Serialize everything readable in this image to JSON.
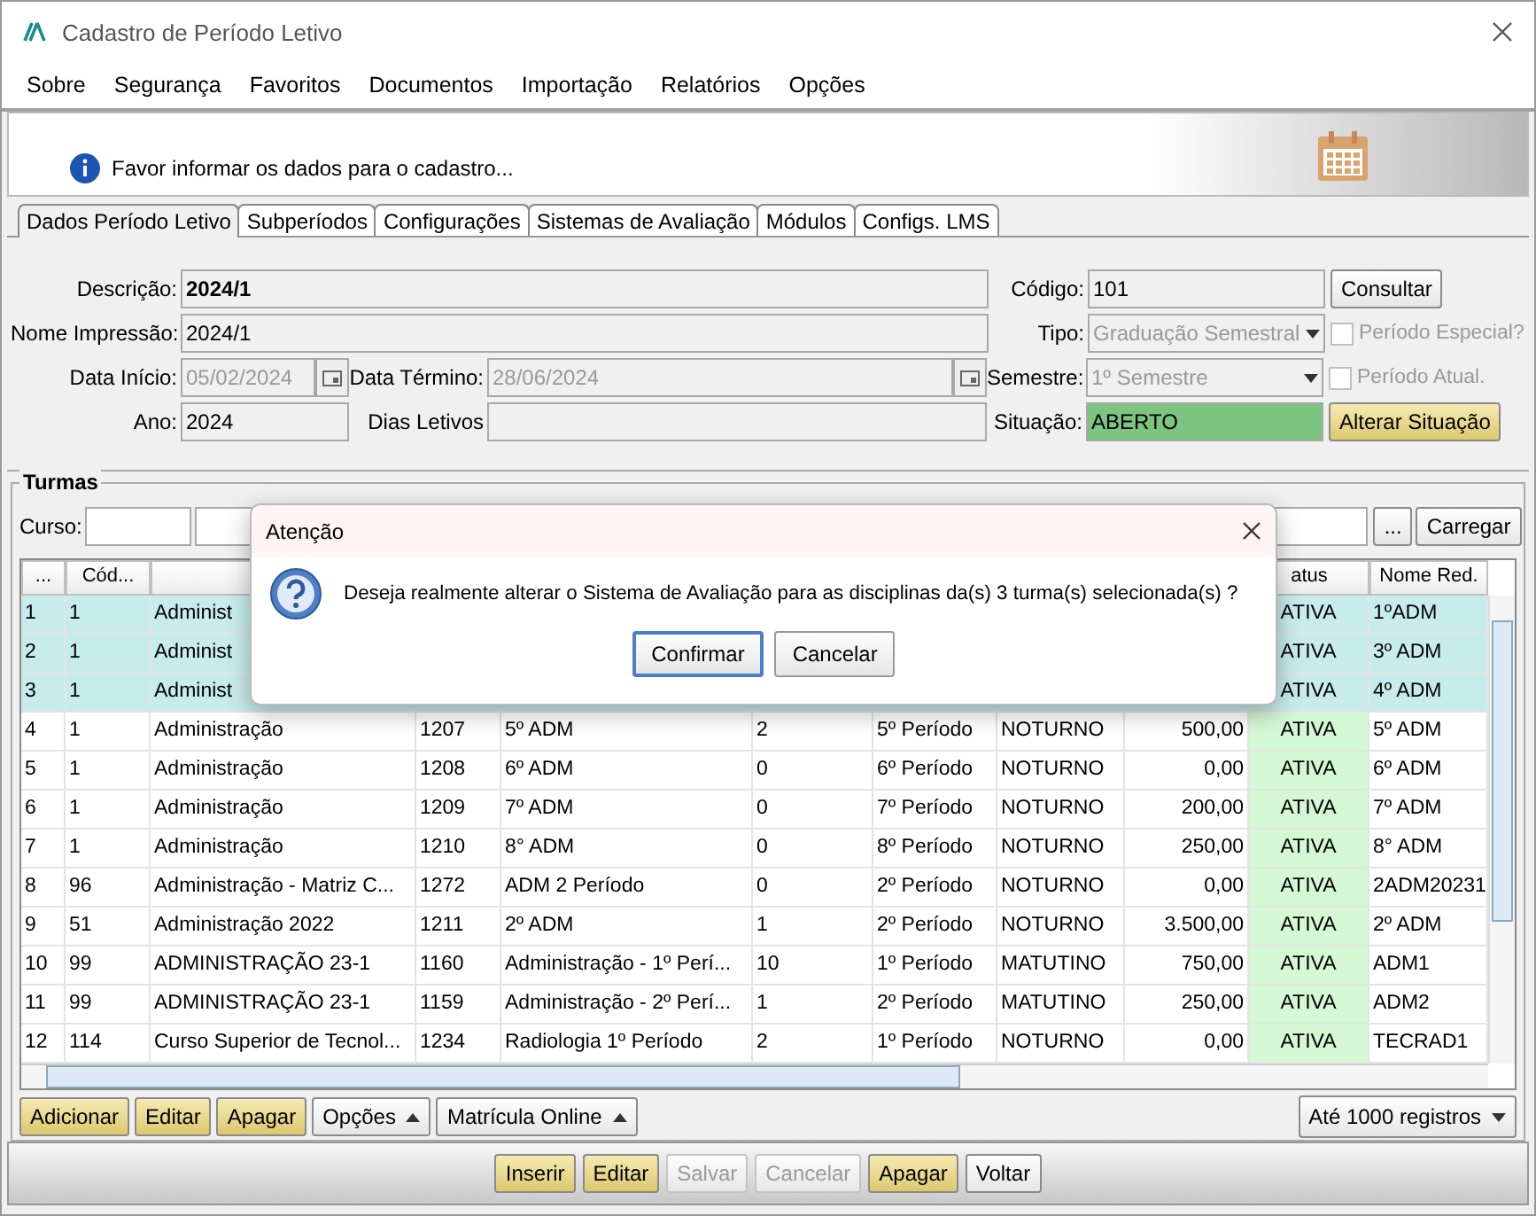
{
  "window": {
    "title": "Cadastro de Período Letivo"
  },
  "menu": [
    "Sobre",
    "Segurança",
    "Favoritos",
    "Documentos",
    "Importação",
    "Relatórios",
    "Opções"
  ],
  "banner": {
    "message": "Favor informar os dados para o cadastro..."
  },
  "tabs": [
    {
      "label": "Dados Período Letivo",
      "selected": true
    },
    {
      "label": "Subperíodos",
      "selected": false
    },
    {
      "label": "Configurações",
      "selected": false
    },
    {
      "label": "Sistemas de Avaliação",
      "selected": false
    },
    {
      "label": "Módulos",
      "selected": false
    },
    {
      "label": "Configs. LMS",
      "selected": false
    }
  ],
  "form": {
    "descricao": {
      "label": "Descrição:",
      "value": "2024/1"
    },
    "nome_impressao": {
      "label": "Nome Impressão:",
      "value": "2024/1"
    },
    "data_inicio": {
      "label": "Data Início:",
      "value": "05/02/2024",
      "disabled": true
    },
    "data_termino": {
      "label": "Data Término:",
      "value": "28/06/2024",
      "disabled": true
    },
    "ano": {
      "label": "Ano:",
      "value": "2024"
    },
    "dias_letivos": {
      "label": "Dias Letivos"
    },
    "codigo": {
      "label": "Código:",
      "value": "101"
    },
    "consultar": {
      "label": "Consultar",
      "kind": "plain"
    },
    "tipo": {
      "label": "Tipo:",
      "value": "Graduação Semestral",
      "disabled": true
    },
    "periodo_especial": {
      "label": "Período Especial?",
      "checked": false,
      "disabled": true
    },
    "semestre": {
      "label": "Semestre:",
      "value": "1º Semestre",
      "disabled": true
    },
    "periodo_atual": {
      "label": "Período Atual.",
      "checked": false,
      "disabled": true
    },
    "situacao": {
      "label": "Situação:",
      "value": "ABERTO",
      "color": "#7cc47f"
    },
    "alterar_situacao": {
      "label": "Alterar Situação",
      "kind": "accent"
    }
  },
  "turmas": {
    "title": "Turmas",
    "curso_label": "Curso:",
    "browse_button": "...",
    "load_button": "Carregar",
    "columns": [
      "...",
      "Cód...",
      null,
      null,
      null,
      null,
      null,
      null,
      null,
      "atus",
      "Nome Red."
    ],
    "rows": [
      {
        "selected": true,
        "cells": [
          "1",
          "1",
          "Administ",
          null,
          null,
          null,
          null,
          null,
          null,
          "ATIVA",
          "1ºADM"
        ]
      },
      {
        "selected": true,
        "cells": [
          "2",
          "1",
          "Administ",
          null,
          null,
          null,
          null,
          null,
          null,
          "ATIVA",
          "3º ADM"
        ]
      },
      {
        "selected": true,
        "cells": [
          "3",
          "1",
          "Administ",
          null,
          null,
          null,
          null,
          null,
          null,
          "ATIVA",
          "4º ADM"
        ]
      },
      {
        "selected": false,
        "cells": [
          "4",
          "1",
          "Administração",
          "1207",
          "5º ADM",
          "2",
          "5º Período",
          "NOTURNO",
          "500,00",
          "ATIVA",
          "5º ADM"
        ]
      },
      {
        "selected": false,
        "cells": [
          "5",
          "1",
          "Administração",
          "1208",
          "6º ADM",
          "0",
          "6º Período",
          "NOTURNO",
          "0,00",
          "ATIVA",
          "6º ADM"
        ]
      },
      {
        "selected": false,
        "cells": [
          "6",
          "1",
          "Administração",
          "1209",
          "7º ADM",
          "0",
          "7º Período",
          "NOTURNO",
          "200,00",
          "ATIVA",
          "7º ADM"
        ]
      },
      {
        "selected": false,
        "cells": [
          "7",
          "1",
          "Administração",
          "1210",
          "8° ADM",
          "0",
          "8º Período",
          "NOTURNO",
          "250,00",
          "ATIVA",
          "8° ADM"
        ]
      },
      {
        "selected": false,
        "cells": [
          "8",
          "96",
          "Administração - Matriz C...",
          "1272",
          "ADM 2 Período",
          "0",
          "2º Período",
          "NOTURNO",
          "0,00",
          "ATIVA",
          "2ADM20231"
        ]
      },
      {
        "selected": false,
        "cells": [
          "9",
          "51",
          "Administração 2022",
          "1211",
          "2º ADM",
          "1",
          "2º Período",
          "NOTURNO",
          "3.500,00",
          "ATIVA",
          "2º ADM"
        ]
      },
      {
        "selected": false,
        "cells": [
          "10",
          "99",
          "ADMINISTRAÇÃO 23-1",
          "1160",
          "Administração - 1º Perí...",
          "10",
          "1º Período",
          "MATUTINO",
          "750,00",
          "ATIVA",
          "ADM1"
        ]
      },
      {
        "selected": false,
        "cells": [
          "11",
          "99",
          "ADMINISTRAÇÃO 23-1",
          "1159",
          "Administração - 2º Perí...",
          "1",
          "2º Período",
          "MATUTINO",
          "250,00",
          "ATIVA",
          "ADM2"
        ]
      },
      {
        "selected": false,
        "cells": [
          "12",
          "114",
          "Curso Superior de Tecnol...",
          "1234",
          "Radiologia 1º Período",
          "2",
          "1º Período",
          "NOTURNO",
          "0,00",
          "ATIVA",
          "TECRAD1"
        ]
      }
    ],
    "actions": [
      {
        "label": "Adicionar",
        "kind": "accent"
      },
      {
        "label": "Editar",
        "kind": "accent"
      },
      {
        "label": "Apagar",
        "kind": "accent"
      },
      {
        "label": "Opções",
        "kind": "menu"
      },
      {
        "label": "Matrícula Online",
        "kind": "menu"
      }
    ],
    "limit": "Até 1000 registros"
  },
  "footer_buttons": [
    {
      "label": "Inserir",
      "kind": "accent",
      "disabled": false
    },
    {
      "label": "Editar",
      "kind": "accent",
      "disabled": false
    },
    {
      "label": "Salvar",
      "kind": "plain",
      "disabled": true
    },
    {
      "label": "Cancelar",
      "kind": "plain",
      "disabled": true
    },
    {
      "label": "Apagar",
      "kind": "accent",
      "disabled": false
    },
    {
      "label": "Voltar",
      "kind": "plain",
      "disabled": false
    }
  ],
  "dialog": {
    "title": "Atenção",
    "message": "Deseja realmente alterar o Sistema de Avaliação para as disciplinas da(s) 3 turma(s) selecionada(s) ?",
    "buttons": [
      {
        "label": "Confirmar",
        "default": true
      },
      {
        "label": "Cancelar",
        "default": false
      }
    ]
  }
}
